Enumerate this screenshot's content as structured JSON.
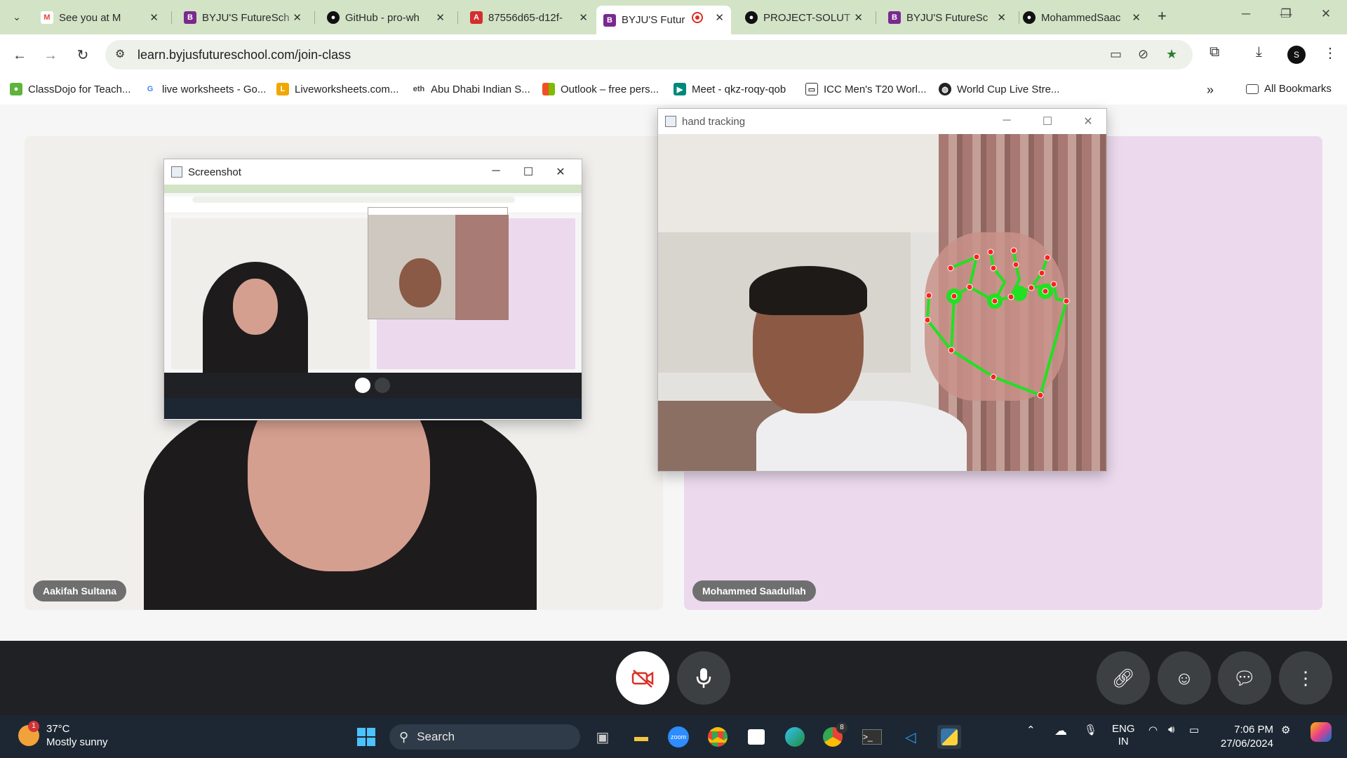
{
  "browser": {
    "tabs": [
      {
        "title": "See you at M",
        "favicon": "gmail-icon",
        "color": "#ea4335"
      },
      {
        "title": "BYJU'S FutureSch",
        "favicon": "byjus-icon",
        "color": "#7a2a8f"
      },
      {
        "title": "GitHub - pro-wh",
        "favicon": "github-icon",
        "color": "#111111"
      },
      {
        "title": "87556d65-d12f-",
        "favicon": "pdf-icon",
        "color": "#d32f2f"
      },
      {
        "title": "BYJU'S Futur",
        "favicon": "byjus-icon",
        "color": "#7a2a8f",
        "active": true
      },
      {
        "title": "PROJECT-SOLUT",
        "favicon": "github-icon",
        "color": "#111111"
      },
      {
        "title": "BYJU'S FutureSc",
        "favicon": "byjus-icon",
        "color": "#7a2a8f"
      },
      {
        "title": "MohammedSaac",
        "favicon": "github-icon",
        "color": "#111111"
      }
    ],
    "url": "learn.byjusfutureschool.com/join-class",
    "profile_initial": "S",
    "bookmarks": [
      {
        "label": "ClassDojo for Teach...",
        "color": "#5fb43b"
      },
      {
        "label": "live worksheets - Go...",
        "color": "#4285f4"
      },
      {
        "label": "Liveworksheets.com...",
        "color": "#f0a700"
      },
      {
        "label": "Abu Dhabi Indian S...",
        "color": "#444444"
      },
      {
        "label": "Outlook – free pers...",
        "color": "#f25022"
      },
      {
        "label": "Meet - qkz-roqy-qob",
        "color": "#00897b"
      },
      {
        "label": "ICC Men's T20 Worl...",
        "color": "#333333"
      },
      {
        "label": "World Cup Live Stre...",
        "color": "#222222"
      }
    ],
    "all_bookmarks_label": "All Bookmarks"
  },
  "meeting": {
    "participants": [
      {
        "name": "Aakifah Sultana"
      },
      {
        "name": "Mohammed Saadullah"
      }
    ],
    "screenshot_window_title": "Screenshot",
    "hand_tracking_window_title": "hand tracking"
  },
  "taskbar": {
    "weather_temp": "37°C",
    "weather_desc": "Mostly sunny",
    "weather_badge": "1",
    "search_placeholder": "Search",
    "chrome_badge": "8",
    "lang_line1": "ENG",
    "lang_line2": "IN",
    "time": "7:06 PM",
    "date": "27/06/2024"
  }
}
